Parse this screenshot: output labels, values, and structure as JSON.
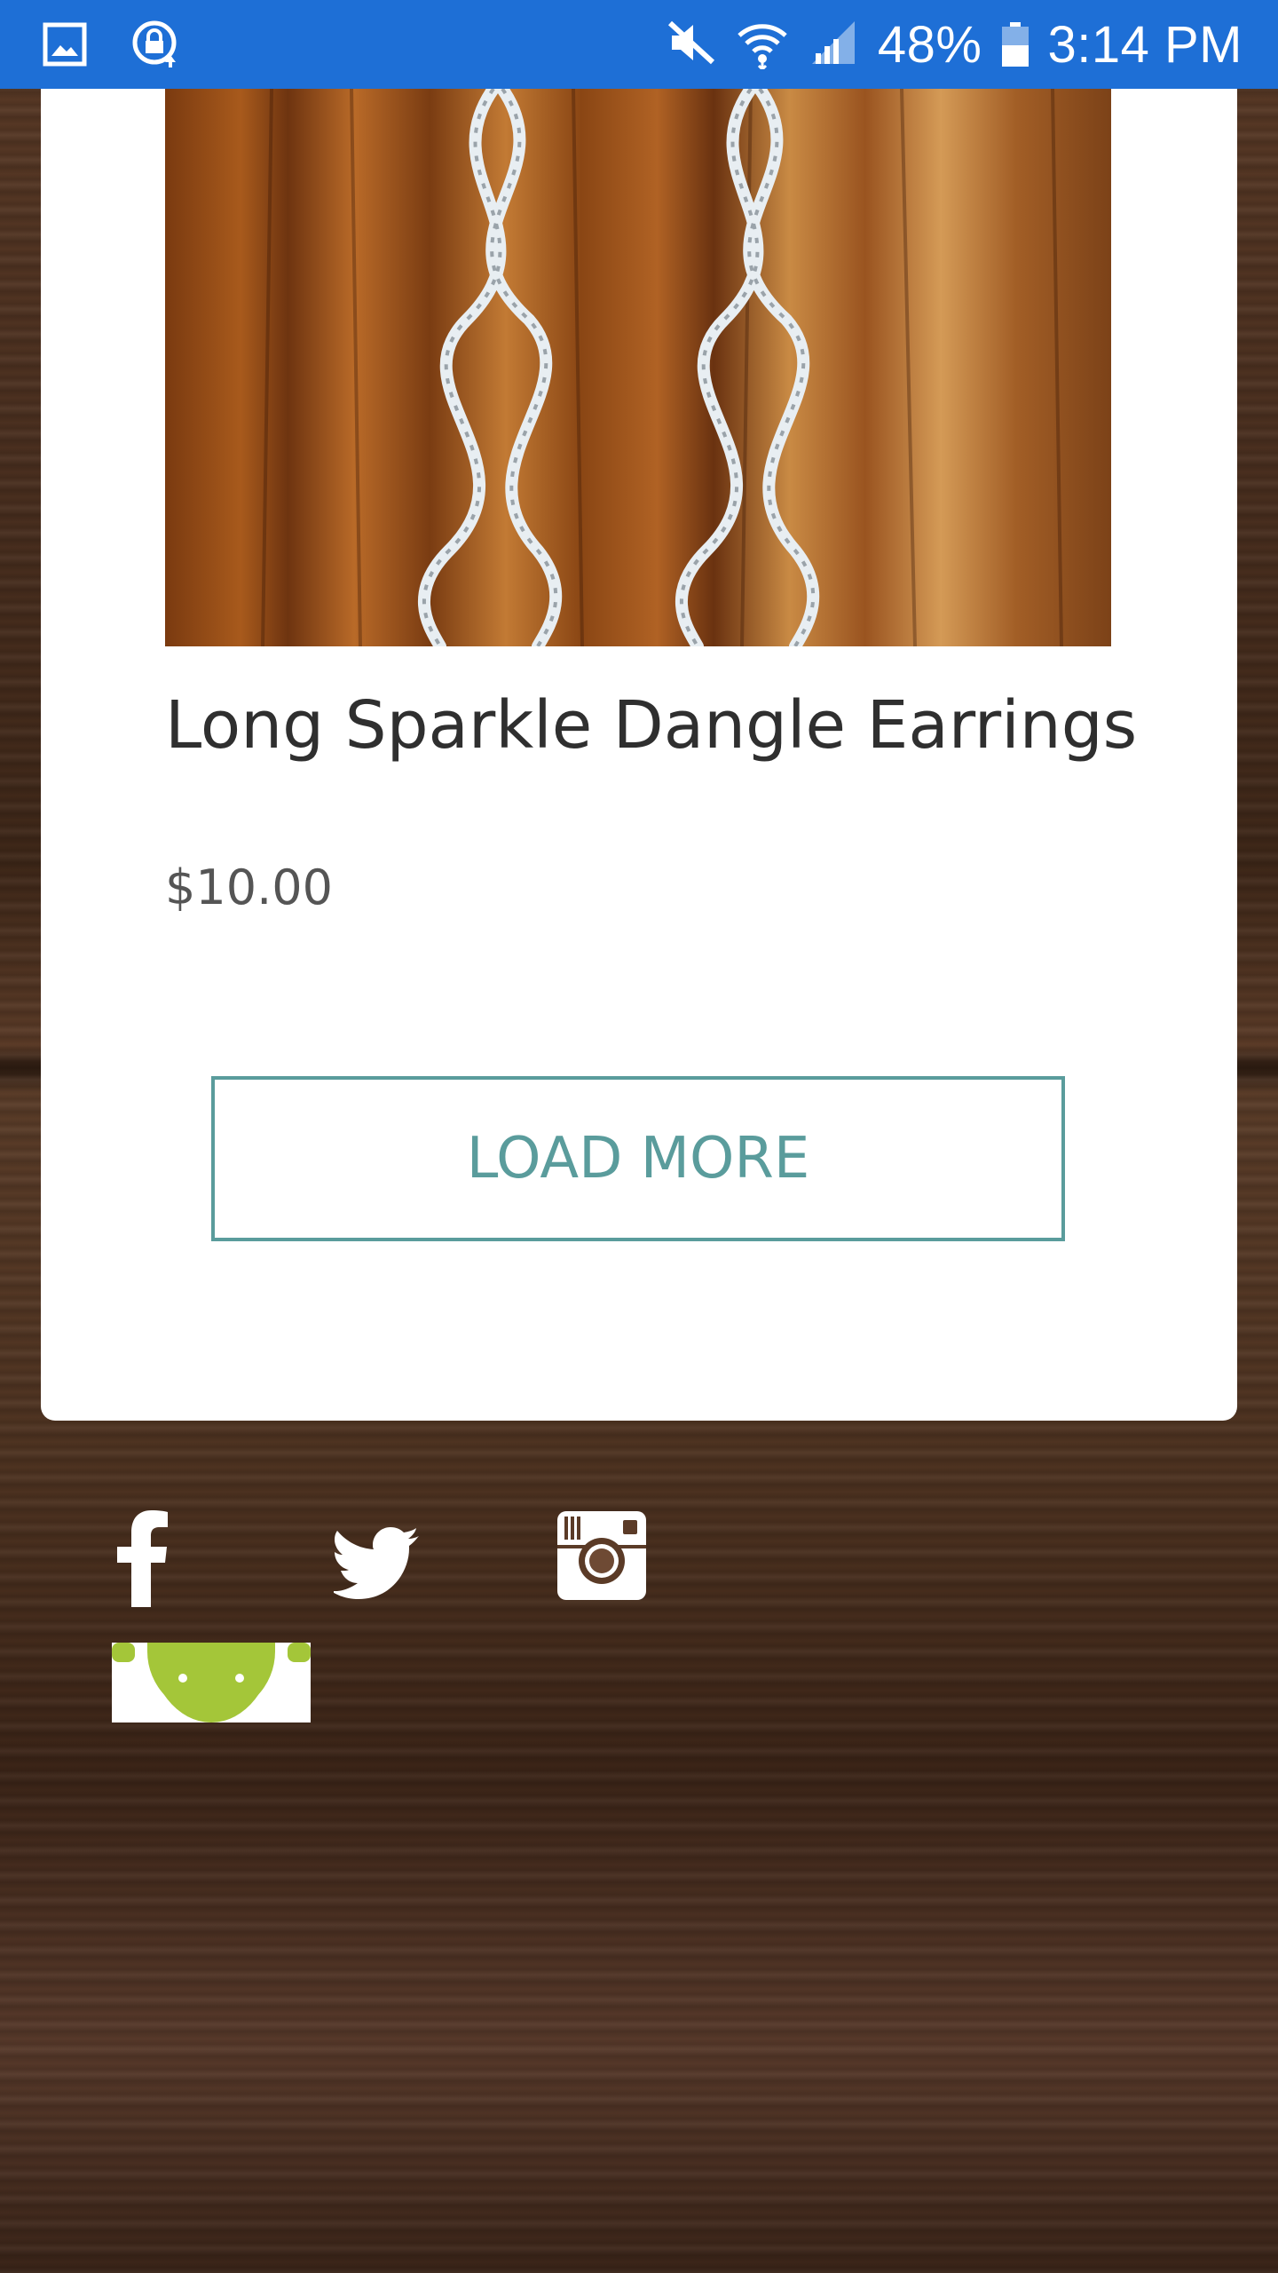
{
  "status_bar": {
    "battery": "48%",
    "time": "3:14 PM",
    "icons": [
      "gallery-icon",
      "vpn-lock-icon",
      "mute-icon",
      "wifi-icon",
      "signal-icon",
      "battery-icon"
    ]
  },
  "product": {
    "image_alt": "Long sparkle dangle earrings on wood",
    "title": "Long Sparkle Dangle Earrings",
    "price": "$10.00"
  },
  "actions": {
    "load_more_label": "LOAD MORE"
  },
  "footer": {
    "social": [
      "facebook-icon",
      "twitter-icon",
      "instagram-icon"
    ],
    "badge": "android-icon"
  },
  "colors": {
    "status_bar": "#1e6fd6",
    "accent": "#5a9c9c",
    "android_green": "#a4c639"
  }
}
